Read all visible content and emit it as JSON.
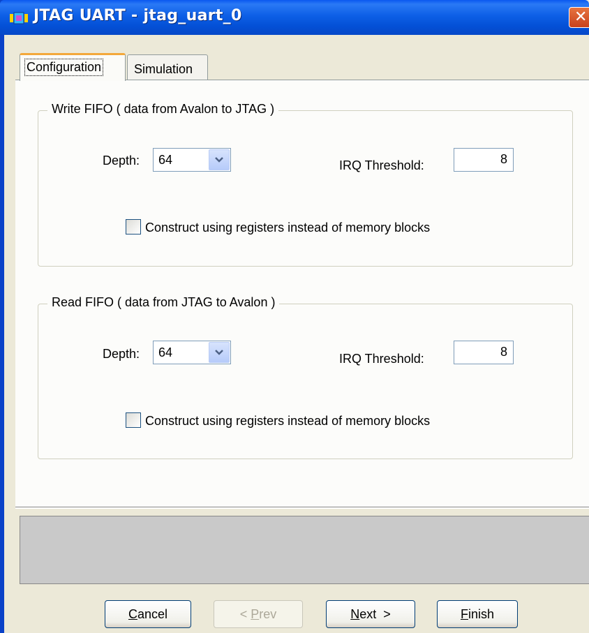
{
  "window": {
    "title": "JTAG UART - jtag_uart_0",
    "close_icon": "close-icon"
  },
  "tabs": [
    {
      "label": "Configuration",
      "selected": true
    },
    {
      "label": "Simulation",
      "selected": false
    }
  ],
  "write_fifo": {
    "title": "Write FIFO ( data from Avalon to JTAG )",
    "depth_label": "Depth:",
    "depth_value": "64",
    "irq_label": "IRQ Threshold:",
    "irq_value": "8",
    "checkbox_label": "Construct using registers instead of memory blocks",
    "checkbox_checked": false
  },
  "read_fifo": {
    "title": "Read FIFO ( data from JTAG to Avalon )",
    "depth_label": "Depth:",
    "depth_value": "64",
    "irq_label": "IRQ Threshold:",
    "irq_value": "8",
    "checkbox_label": "Construct using registers instead of memory blocks",
    "checkbox_checked": false
  },
  "buttons": {
    "cancel": {
      "first": "C",
      "rest": "ancel"
    },
    "prev": {
      "pre": "< ",
      "first": "P",
      "rest": "rev",
      "enabled": false
    },
    "next": {
      "first": "N",
      "rest": "ext  >"
    },
    "finish": {
      "first": "F",
      "rest": "inish"
    }
  },
  "colors": {
    "titlebar": "#0a58f0",
    "tab_accent": "#f3a83a",
    "dialog_bg": "#ece9d8",
    "panel_bg": "#fcfcfa",
    "message_area": "#c9c9c9"
  }
}
